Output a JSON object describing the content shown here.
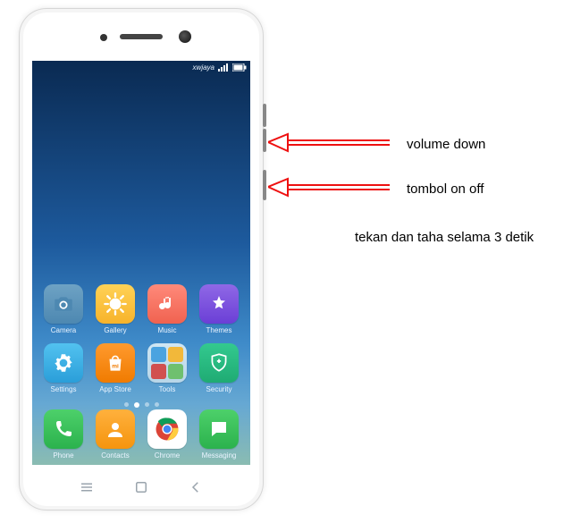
{
  "statusbar": {
    "carrier": "xwjaya"
  },
  "apps_top": [
    {
      "id": "camera",
      "label": "Camera"
    },
    {
      "id": "gallery",
      "label": "Gallery"
    },
    {
      "id": "music",
      "label": "Music"
    },
    {
      "id": "themes",
      "label": "Themes"
    }
  ],
  "apps_mid": [
    {
      "id": "settings",
      "label": "Settings"
    },
    {
      "id": "appstore",
      "label": "App Store"
    },
    {
      "id": "tools",
      "label": "Tools"
    },
    {
      "id": "security",
      "label": "Security"
    }
  ],
  "dock": [
    {
      "id": "phone",
      "label": "Phone"
    },
    {
      "id": "contacts",
      "label": "Contacts"
    },
    {
      "id": "chrome",
      "label": "Chrome"
    },
    {
      "id": "messaging",
      "label": "Messaging"
    }
  ],
  "pages": {
    "total": 4,
    "active": 1
  },
  "annotations": {
    "volume_down": "volume down",
    "power": "tombol on off",
    "instruction": "tekan dan taha selama 3 detik"
  }
}
